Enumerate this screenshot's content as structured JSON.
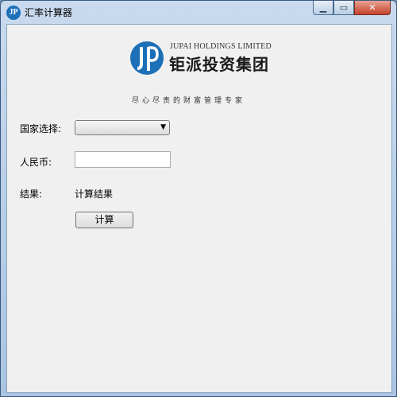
{
  "window": {
    "title": "汇率计算器"
  },
  "logo": {
    "english_name": "JUPAI HOLDINGS LIMITED",
    "chinese_name": "钜派投资集团",
    "slogan": "尽心尽责的财富管理专家"
  },
  "form": {
    "country_label": "国家选择:",
    "country_value": "",
    "rmb_label": "人民币:",
    "rmb_value": "",
    "result_label": "结果:",
    "result_value": "计算结果",
    "calculate_label": "计算"
  },
  "colors": {
    "logo_blue": "#1d6fb8",
    "window_frame": "#a9c4e2",
    "client_bg": "#f0f0f0"
  }
}
